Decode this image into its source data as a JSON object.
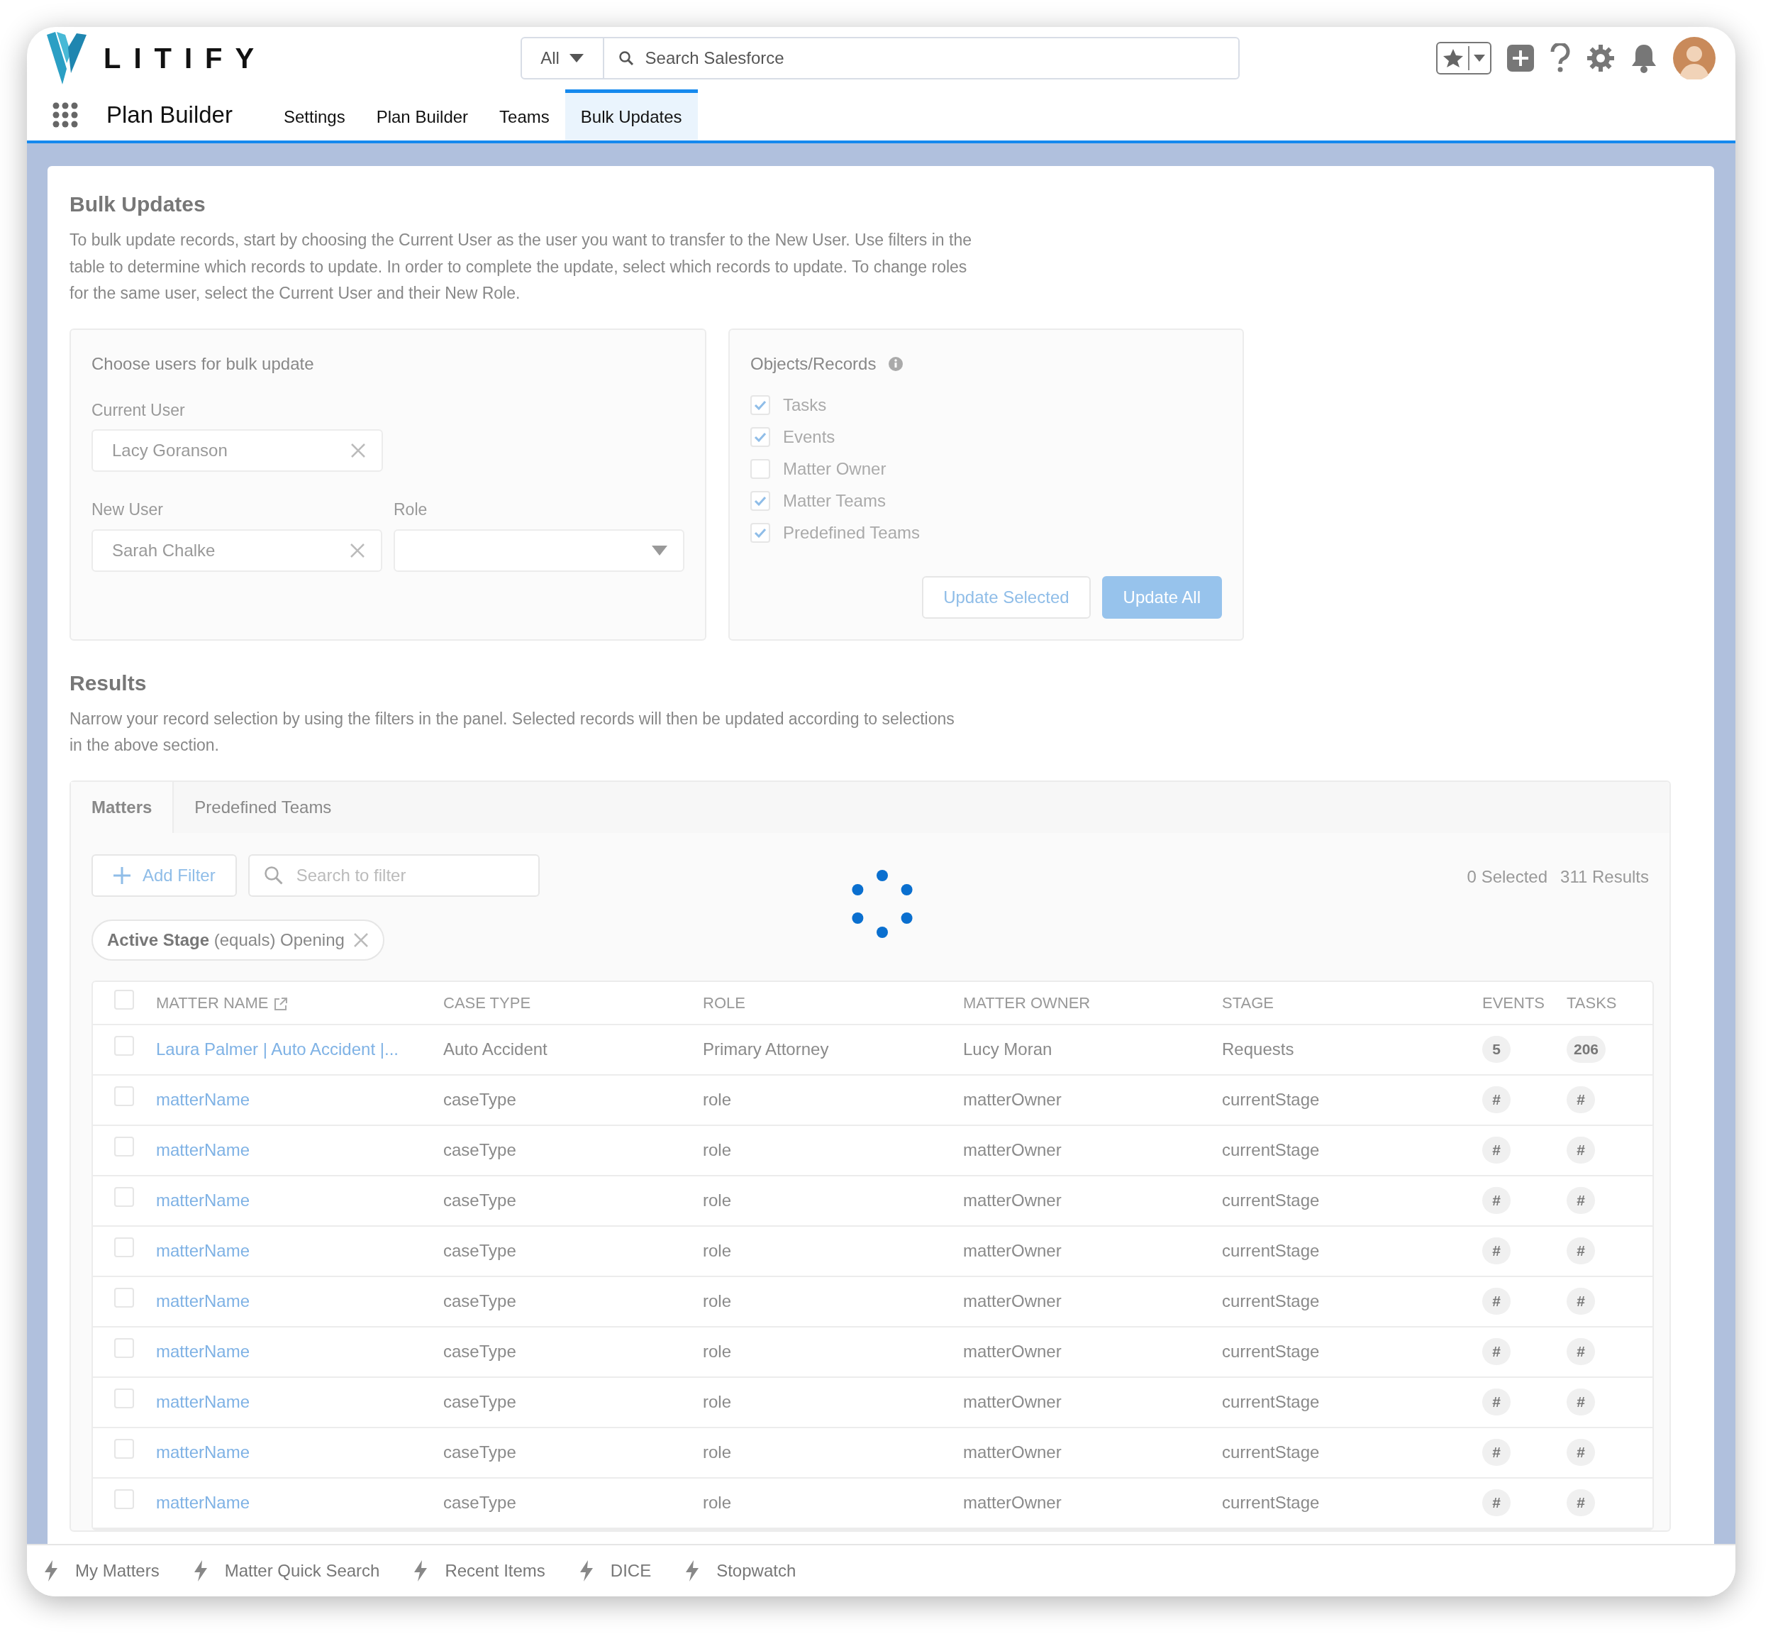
{
  "app": {
    "logo": "LITIFY",
    "search_scope": "All",
    "search_placeholder": "Search Salesforce",
    "app_name": "Plan Builder",
    "nav": [
      {
        "label": "Settings",
        "selected": false
      },
      {
        "label": "Plan Builder",
        "selected": false
      },
      {
        "label": "Teams",
        "selected": false
      },
      {
        "label": "Bulk Updates",
        "selected": true
      }
    ]
  },
  "page": {
    "title": "Bulk Updates",
    "description": "To bulk update records, start by choosing the Current User as the user you want to transfer to the New User. Use filters in the table to determine which records to update. In order to complete the update, select which records to update. To change roles for the same user, select the Current User and their New Role."
  },
  "users_panel": {
    "title": "Choose users for bulk update",
    "current_user_label": "Current User",
    "current_user_value": "Lacy Goranson",
    "new_user_label": "New User",
    "new_user_value": "Sarah Chalke",
    "role_label": "Role"
  },
  "objects_panel": {
    "title": "Objects/Records",
    "items": [
      {
        "label": "Tasks",
        "checked": true
      },
      {
        "label": "Events",
        "checked": true
      },
      {
        "label": "Matter Owner",
        "checked": false
      },
      {
        "label": "Matter Teams",
        "checked": true
      },
      {
        "label": "Predefined Teams",
        "checked": true
      }
    ],
    "buttons": [
      {
        "label": "Update Selected",
        "kind": "outline"
      },
      {
        "label": "Update All",
        "kind": "primary"
      }
    ]
  },
  "results": {
    "title": "Results",
    "description": "Narrow your record selection by using the filters in the panel. Selected records will then be updated according to selections in the above section.",
    "tabs": [
      {
        "label": "Matters",
        "selected": true
      },
      {
        "label": "Predefined Teams",
        "selected": false
      }
    ],
    "add_filter": "Add Filter",
    "search_placeholder": "Search to filter",
    "loading": true,
    "selected_count": "0 Selected",
    "results_count": "311 Results",
    "filter_pill": "**Active Stage** (equals) Opening",
    "all_checked": false,
    "columns": [
      "MATTER NAME",
      "CASE TYPE",
      "ROLE",
      "MATTER OWNER",
      "STAGE",
      "EVENTS",
      "TASKS"
    ],
    "rows": [
      {
        "checked": false,
        "matter_name": "Laura Palmer | Auto Accident |...",
        "case_type": "Auto Accident",
        "role": "Primary Attorney",
        "matter_owner": "Lucy Moran",
        "stage": "Requests",
        "events": "5",
        "tasks": "206"
      },
      {
        "checked": false,
        "matter_name": "matterName",
        "case_type": "caseType",
        "role": "role",
        "matter_owner": "matterOwner",
        "stage": "currentStage",
        "events": "#",
        "tasks": "#"
      },
      {
        "checked": false,
        "matter_name": "matterName",
        "case_type": "caseType",
        "role": "role",
        "matter_owner": "matterOwner",
        "stage": "currentStage",
        "events": "#",
        "tasks": "#"
      },
      {
        "checked": false,
        "matter_name": "matterName",
        "case_type": "caseType",
        "role": "role",
        "matter_owner": "matterOwner",
        "stage": "currentStage",
        "events": "#",
        "tasks": "#"
      },
      {
        "checked": false,
        "matter_name": "matterName",
        "case_type": "caseType",
        "role": "role",
        "matter_owner": "matterOwner",
        "stage": "currentStage",
        "events": "#",
        "tasks": "#"
      },
      {
        "checked": false,
        "matter_name": "matterName",
        "case_type": "caseType",
        "role": "role",
        "matter_owner": "matterOwner",
        "stage": "currentStage",
        "events": "#",
        "tasks": "#"
      },
      {
        "checked": false,
        "matter_name": "matterName",
        "case_type": "caseType",
        "role": "role",
        "matter_owner": "matterOwner",
        "stage": "currentStage",
        "events": "#",
        "tasks": "#"
      },
      {
        "checked": false,
        "matter_name": "matterName",
        "case_type": "caseType",
        "role": "role",
        "matter_owner": "matterOwner",
        "stage": "currentStage",
        "events": "#",
        "tasks": "#"
      },
      {
        "checked": false,
        "matter_name": "matterName",
        "case_type": "caseType",
        "role": "role",
        "matter_owner": "matterOwner",
        "stage": "currentStage",
        "events": "#",
        "tasks": "#"
      },
      {
        "checked": false,
        "matter_name": "matterName",
        "case_type": "caseType",
        "role": "role",
        "matter_owner": "matterOwner",
        "stage": "currentStage",
        "events": "#",
        "tasks": "#"
      }
    ]
  },
  "utility_bar": [
    "My Matters",
    "Matter Quick Search",
    "Recent Items",
    "DICE",
    "Stopwatch"
  ]
}
